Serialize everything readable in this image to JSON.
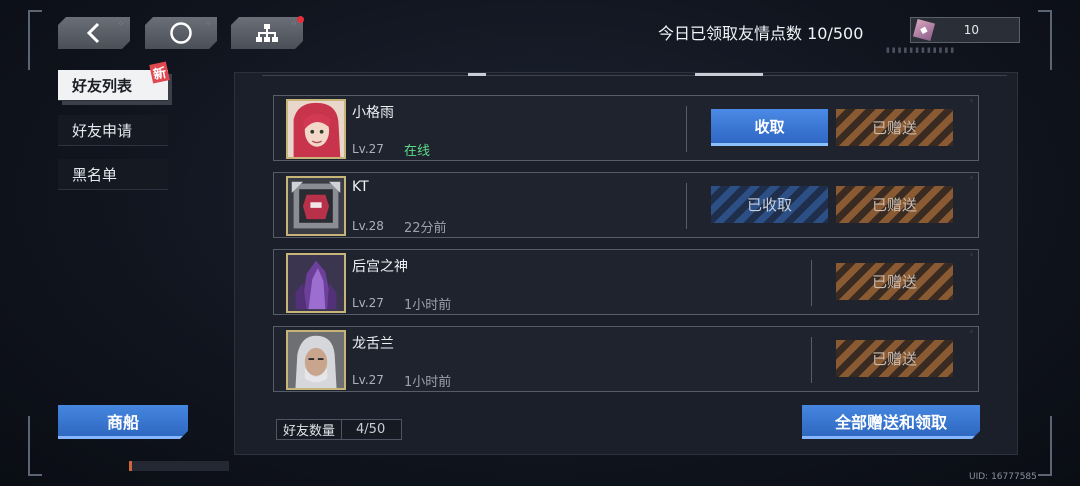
{
  "header": {
    "back_icon": "chevron-left-icon",
    "home_icon": "circle-icon",
    "tree_icon": "hierarchy-icon",
    "counter_text": "今日已领取友情点数 10/500",
    "currency_value": "10",
    "currency_icon": "gem-icon"
  },
  "sidebar": {
    "items": [
      {
        "label": "好友列表",
        "active": true
      },
      {
        "label": "好友申请",
        "active": false
      },
      {
        "label": "黑名单",
        "active": false
      }
    ],
    "new_badge": "新",
    "ship_button": "商船"
  },
  "friends": [
    {
      "name": "小格雨",
      "level": "Lv.27",
      "status": "在线",
      "online": true,
      "receive_label": "收取",
      "sent_label": "已赠送"
    },
    {
      "name": "KT",
      "level": "Lv.28",
      "status": "22分前",
      "online": false,
      "received_label": "已收取",
      "sent_label": "已赠送"
    },
    {
      "name": "后宫之神",
      "level": "Lv.27",
      "status": "1小时前",
      "online": false,
      "sent_label": "已赠送"
    },
    {
      "name": "龙舌兰",
      "level": "Lv.27",
      "status": "1小时前",
      "online": false,
      "sent_label": "已赠送"
    }
  ],
  "footer": {
    "count_label": "好友数量",
    "count_value": "4/50",
    "all_button": "全部赠送和领取",
    "uid": "UID: 16777585"
  },
  "colors": {
    "accent_blue": "#2f66c4",
    "online_green": "#5fd98a",
    "sent_orange": "#8a5a33",
    "notification_red": "#e3303a"
  }
}
